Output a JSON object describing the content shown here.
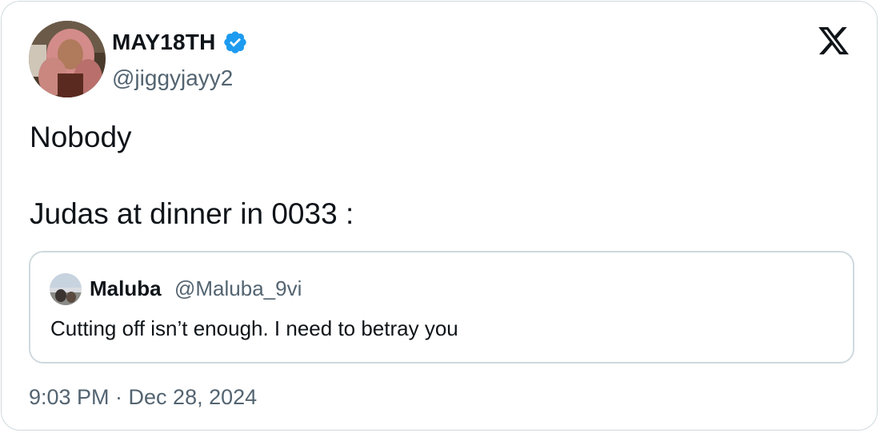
{
  "author": {
    "display_name": "MAY18TH",
    "handle": "@jiggyjayy2",
    "verified": true
  },
  "tweet": {
    "lines": [
      "Nobody",
      "Judas at dinner in 0033 :"
    ]
  },
  "quoted_tweet": {
    "display_name": "Maluba",
    "handle": "@Maluba_9vi",
    "text": "Cutting off isn’t enough. I need to betray you"
  },
  "timestamp": "9:03 PM · Dec 28, 2024",
  "icons": {
    "brand": "x-logo-icon",
    "verified": "verified-badge-icon"
  },
  "colors": {
    "text": "#0f1419",
    "secondary": "#536471",
    "verified": "#1d9bf0",
    "border": "#cfd9de"
  }
}
